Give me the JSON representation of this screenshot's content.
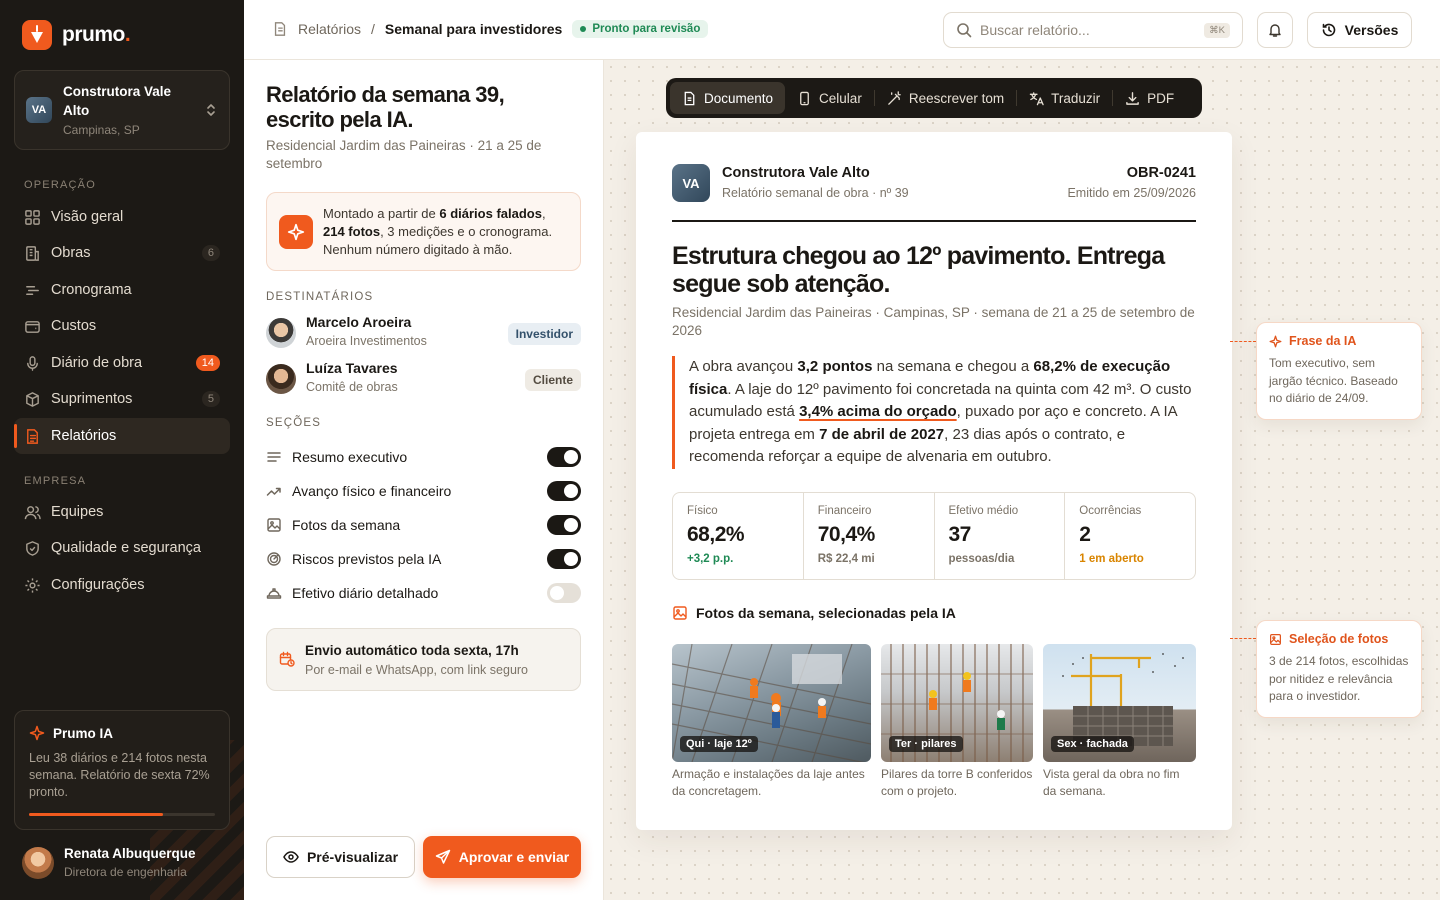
{
  "sidebar": {
    "logo_text": "prumo",
    "logo_dot": ".",
    "company": {
      "initials": "VA",
      "name": "Construtora Vale Alto",
      "location": "Campinas, SP"
    },
    "section_operation": "OPERAÇÃO",
    "section_company": "EMPRESA",
    "items": [
      {
        "label": "Visão geral",
        "icon": "grid-icon"
      },
      {
        "label": "Obras",
        "count": "6",
        "icon": "building-icon"
      },
      {
        "label": "Cronograma",
        "icon": "timeline-icon"
      },
      {
        "label": "Custos",
        "icon": "wallet-icon"
      },
      {
        "label": "Diário de obra",
        "count": "14",
        "icon": "microphone-icon"
      },
      {
        "label": "Suprimentos",
        "count": "5",
        "icon": "box-icon"
      },
      {
        "label": "Relatórios",
        "icon": "report-icon",
        "active": true
      },
      {
        "label": "Equipes",
        "icon": "users-icon"
      },
      {
        "label": "Qualidade e segurança",
        "icon": "shield-icon"
      },
      {
        "label": "Configurações",
        "icon": "gear-icon"
      }
    ],
    "ia_card": {
      "title": "Prumo IA",
      "text": "Leu 38 diários e 214 fotos nesta semana. Relatório de sexta 72% pronto.",
      "progress": 0.72
    },
    "user": {
      "name": "Renata Albuquerque",
      "role": "Diretora de engenharia"
    }
  },
  "topbar": {
    "crumb_root": "Relatórios",
    "crumb_sep": "/",
    "crumb_current": "Semanal para investidores",
    "status": "Pronto para revisão",
    "search_placeholder": "Buscar relatório...",
    "shortcut": "⌘K",
    "versions_label": "Versões"
  },
  "editor": {
    "title": "Relatório da semana 39, escrito pela IA.",
    "subtitle": "Residencial Jardim das Paineiras · 21 a 25 de setembro",
    "info": {
      "p1": "Montado a partir de ",
      "b1": "6 diários falados",
      "p2": ", ",
      "b2": "214 fotos",
      "p3": ", 3 medições e o cronograma. Nenhum número digitado à mão."
    },
    "recipients_label": "DESTINATÁRIOS",
    "recipients": [
      {
        "name": "Marcelo Aroeira",
        "org": "Aroeira Investimentos",
        "tag": "Investidor"
      },
      {
        "name": "Luíza Tavares",
        "org": "Comitê de obras",
        "tag": "Cliente"
      }
    ],
    "sections_label": "SEÇÕES",
    "sections": [
      {
        "label": "Resumo executivo",
        "on": true
      },
      {
        "label": "Avanço físico e financeiro",
        "on": true
      },
      {
        "label": "Fotos da semana",
        "on": true
      },
      {
        "label": "Riscos previstos pela IA",
        "on": true
      },
      {
        "label": "Efetivo diário detalhado",
        "on": false
      }
    ],
    "auto_send": {
      "title": "Envio automático toda sexta, 17h",
      "desc": "Por e-mail e WhatsApp, com link seguro"
    },
    "preview_label": "Pré-visualizar",
    "send_label": "Aprovar e enviar"
  },
  "toolbar": {
    "items": [
      {
        "label": "Documento",
        "icon": "document-icon",
        "active": true
      },
      {
        "label": "Celular",
        "icon": "phone-icon"
      },
      {
        "label": "Reescrever tom",
        "icon": "wand-icon"
      },
      {
        "label": "Traduzir",
        "icon": "translate-icon"
      },
      {
        "label": "PDF",
        "icon": "download-icon"
      }
    ]
  },
  "document": {
    "initials": "VA",
    "company": "Construtora Vale Alto",
    "doc_type": "Relatório semanal de obra · nº 39",
    "code": "OBR-0241",
    "issued": "Emitido em 25/09/2026",
    "headline": "Estrutura chegou ao 12º pavimento. Entrega segue sob atenção.",
    "location": "Residencial Jardim das Paineiras · Campinas, SP · semana de 21 a 25 de setembro de 2026",
    "summary": {
      "p1": "A obra avançou ",
      "b1": "3,2 pontos",
      "p2": " na semana e chegou a ",
      "b2": "68,2% de execução física",
      "p3": ". A laje do 12º pavimento foi concretada na quinta com 42 m³. O custo acumulado está ",
      "b3": "3,4% acima do orçado",
      "p4": ", puxado por aço e concreto. A IA projeta entrega em ",
      "b4": "7 de abril de 2027",
      "p5": ", 23 dias após o contrato, e recomenda reforçar a equipe de alvenaria em outubro."
    },
    "kpis": [
      {
        "label": "Físico",
        "value": "68,2%",
        "sub": "+3,2 p.p."
      },
      {
        "label": "Financeiro",
        "value": "70,4%",
        "sub": "R$ 22,4 mi"
      },
      {
        "label": "Efetivo médio",
        "value": "37",
        "sub": "pessoas/dia"
      },
      {
        "label": "Ocorrências",
        "value": "2",
        "sub": "1 em aberto"
      }
    ],
    "photos_title": "Fotos da semana, selecionadas pela IA",
    "photos": [
      {
        "caption": "Qui · laje 12º",
        "desc": "Armação e instalações da laje antes da concretagem."
      },
      {
        "caption": "Ter · pilares",
        "desc": "Pilares da torre B conferidos com o projeto."
      },
      {
        "caption": "Sex · fachada",
        "desc": "Vista geral da obra no fim da semana."
      }
    ]
  },
  "notes": [
    {
      "title": "Frase da IA",
      "text": "Tom executivo, sem jargão técnico. Baseado no diário de 24/09."
    },
    {
      "title": "Seleção de fotos",
      "text": "3 de 214 fotos, escolhidas por nitidez e relevância para o investidor."
    }
  ],
  "colors": {
    "accent": "#f05a1e",
    "sidebar": "#1c1915",
    "success": "#1f8a55",
    "warning": "#d98500"
  }
}
